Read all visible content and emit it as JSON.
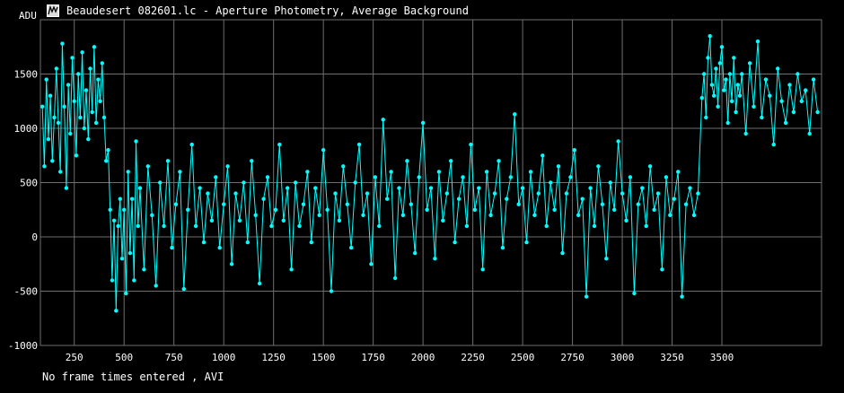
{
  "window": {
    "title": "Beaudesert 082601.lc - Aperture Photometry, Average Background",
    "icon": "app-window-icon"
  },
  "footer": {
    "status": "No frame times entered , AVI"
  },
  "colors": {
    "background": "#000000",
    "grid": "#6e6e6e",
    "series": "#00ffff",
    "text": "#ffffff"
  },
  "chart_data": {
    "type": "line",
    "title": "Beaudesert 082601.lc - Aperture Photometry, Average Background",
    "xlabel": "",
    "ylabel": "ADU",
    "xlim": [
      80,
      4000
    ],
    "ylim": [
      -1000,
      2000
    ],
    "xticks": [
      250,
      500,
      750,
      1000,
      1250,
      1500,
      1750,
      2000,
      2250,
      2500,
      2750,
      3000,
      3250,
      3500
    ],
    "yticks": [
      -1000,
      -500,
      0,
      500,
      1000,
      1500
    ],
    "grid": true,
    "markers": true,
    "series": [
      {
        "name": "",
        "x": [
          90,
          100,
          110,
          120,
          130,
          140,
          150,
          160,
          170,
          180,
          190,
          200,
          210,
          220,
          230,
          240,
          250,
          260,
          270,
          280,
          290,
          300,
          310,
          320,
          330,
          340,
          350,
          360,
          370,
          380,
          390,
          400,
          410,
          420,
          430,
          440,
          450,
          460,
          470,
          480,
          490,
          500,
          510,
          520,
          530,
          540,
          550,
          560,
          570,
          580,
          600,
          620,
          640,
          660,
          680,
          700,
          720,
          740,
          760,
          780,
          800,
          820,
          840,
          860,
          880,
          900,
          920,
          940,
          960,
          980,
          1000,
          1020,
          1040,
          1060,
          1080,
          1100,
          1120,
          1140,
          1160,
          1180,
          1200,
          1220,
          1240,
          1260,
          1280,
          1300,
          1320,
          1340,
          1360,
          1380,
          1400,
          1420,
          1440,
          1460,
          1480,
          1500,
          1520,
          1540,
          1560,
          1580,
          1600,
          1620,
          1640,
          1660,
          1680,
          1700,
          1720,
          1740,
          1760,
          1780,
          1800,
          1820,
          1840,
          1860,
          1880,
          1900,
          1920,
          1940,
          1960,
          1980,
          2000,
          2020,
          2040,
          2060,
          2080,
          2100,
          2120,
          2140,
          2160,
          2180,
          2200,
          2220,
          2240,
          2260,
          2280,
          2300,
          2320,
          2340,
          2360,
          2380,
          2400,
          2420,
          2440,
          2460,
          2480,
          2500,
          2520,
          2540,
          2560,
          2580,
          2600,
          2620,
          2640,
          2660,
          2680,
          2700,
          2720,
          2740,
          2760,
          2780,
          2800,
          2820,
          2840,
          2860,
          2880,
          2900,
          2920,
          2940,
          2960,
          2980,
          3000,
          3020,
          3040,
          3060,
          3080,
          3100,
          3120,
          3140,
          3160,
          3180,
          3200,
          3220,
          3240,
          3260,
          3280,
          3300,
          3320,
          3340,
          3360,
          3380,
          3400,
          3410,
          3420,
          3430,
          3440,
          3450,
          3460,
          3470,
          3480,
          3490,
          3500,
          3510,
          3520,
          3530,
          3540,
          3550,
          3560,
          3570,
          3580,
          3590,
          3600,
          3620,
          3640,
          3660,
          3680,
          3700,
          3720,
          3740,
          3760,
          3780,
          3800,
          3820,
          3840,
          3860,
          3880,
          3900,
          3920,
          3940,
          3960,
          3980
        ],
        "y": [
          1200,
          650,
          1450,
          900,
          1300,
          700,
          1100,
          1550,
          1050,
          600,
          1780,
          1200,
          450,
          1400,
          950,
          1650,
          1250,
          750,
          1500,
          1100,
          1700,
          1000,
          1350,
          900,
          1550,
          1150,
          1750,
          1050,
          1450,
          1250,
          1600,
          1100,
          700,
          800,
          250,
          -400,
          150,
          -680,
          100,
          350,
          -200,
          250,
          -520,
          600,
          -150,
          350,
          -400,
          880,
          100,
          450,
          -300,
          650,
          200,
          -450,
          500,
          100,
          700,
          -100,
          300,
          600,
          -480,
          250,
          850,
          100,
          450,
          -50,
          400,
          150,
          550,
          -100,
          300,
          650,
          -250,
          400,
          150,
          500,
          -50,
          700,
          200,
          -430,
          350,
          550,
          100,
          250,
          850,
          150,
          450,
          -300,
          500,
          100,
          300,
          600,
          -50,
          450,
          200,
          800,
          250,
          -500,
          400,
          150,
          650,
          300,
          -100,
          500,
          850,
          200,
          400,
          -250,
          550,
          100,
          1080,
          350,
          600,
          -380,
          450,
          200,
          700,
          300,
          -150,
          550,
          1050,
          250,
          450,
          -200,
          600,
          150,
          400,
          700,
          -50,
          350,
          550,
          100,
          850,
          250,
          450,
          -300,
          600,
          200,
          400,
          700,
          -100,
          350,
          550,
          1130,
          300,
          450,
          -50,
          600,
          200,
          400,
          750,
          100,
          500,
          250,
          650,
          -150,
          400,
          550,
          800,
          200,
          350,
          -550,
          450,
          100,
          650,
          300,
          -200,
          500,
          250,
          880,
          400,
          150,
          550,
          -520,
          300,
          450,
          100,
          650,
          250,
          400,
          -300,
          550,
          200,
          350,
          600,
          -550,
          300,
          450,
          200,
          400,
          1280,
          1500,
          1100,
          1650,
          1850,
          1400,
          1300,
          1550,
          1200,
          1600,
          1750,
          1350,
          1450,
          1050,
          1500,
          1250,
          1650,
          1150,
          1400,
          1300,
          1500,
          950,
          1600,
          1200,
          1800,
          1100,
          1450,
          1300,
          850,
          1550,
          1250,
          1050,
          1400,
          1150,
          1500,
          1250,
          1350,
          950,
          1450,
          1150
        ]
      }
    ]
  }
}
